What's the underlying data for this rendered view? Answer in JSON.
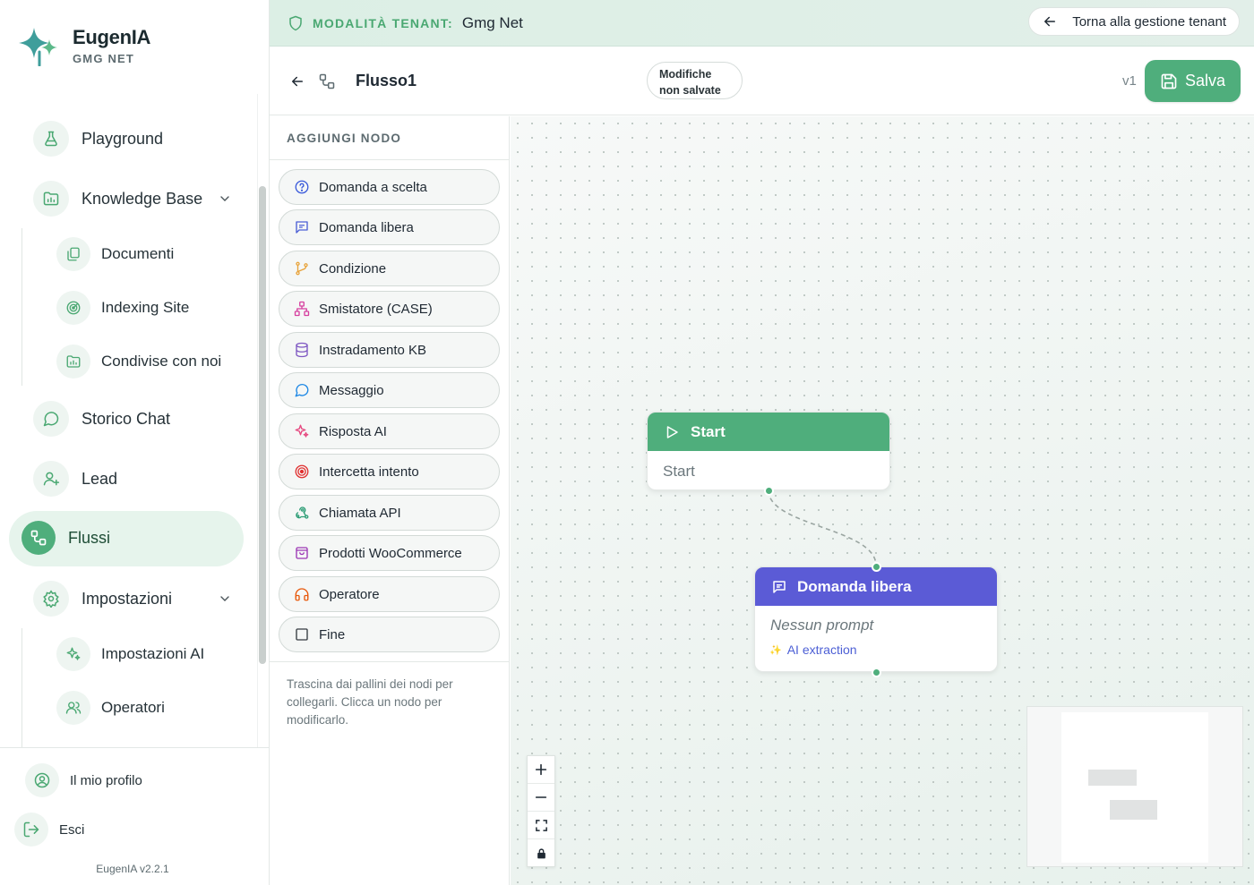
{
  "brand": {
    "name": "EugenIA",
    "tenant_short": "GMG NET"
  },
  "nav": {
    "items": [
      {
        "label": "Playground",
        "icon": "flask-icon"
      },
      {
        "label": "Knowledge Base",
        "icon": "folder-chart-icon"
      },
      {
        "label": "Documenti",
        "icon": "documents-icon"
      },
      {
        "label": "Indexing Site",
        "icon": "radar-icon"
      },
      {
        "label": "Condivise con noi",
        "icon": "folder-chart-icon"
      },
      {
        "label": "Storico Chat",
        "icon": "chat-bubble-icon"
      },
      {
        "label": "Lead",
        "icon": "user-plus-icon"
      },
      {
        "label": "Flussi",
        "icon": "flow-icon",
        "active": true
      },
      {
        "label": "Impostazioni",
        "icon": "gear-icon"
      },
      {
        "label": "Impostazioni AI",
        "icon": "sparkles-icon"
      },
      {
        "label": "Operatori",
        "icon": "users-icon"
      }
    ],
    "profile": "Il mio profilo",
    "logout": "Esci",
    "version": "EugenIA v2.2.1"
  },
  "banner": {
    "label": "MODALITÀ TENANT:",
    "tenant": "Gmg Net",
    "back_label": "Torna alla gestione tenant"
  },
  "toolbar": {
    "flow_name": "Flusso1",
    "unsaved_line1": "Modifiche",
    "unsaved_line2": "non salvate",
    "version": "v1",
    "save_label": "Salva"
  },
  "palette": {
    "title": "AGGIUNGI NODO",
    "items": [
      {
        "label": "Domanda a scelta",
        "icon": "question-circle-icon",
        "color": "#3b5bdb"
      },
      {
        "label": "Domanda libera",
        "icon": "message-square-icon",
        "color": "#4c5fd5"
      },
      {
        "label": "Condizione",
        "icon": "git-branch-icon",
        "color": "#e8a33a"
      },
      {
        "label": "Smistatore (CASE)",
        "icon": "network-icon",
        "color": "#d6409f"
      },
      {
        "label": "Instradamento KB",
        "icon": "database-icon",
        "color": "#7e57c2"
      },
      {
        "label": "Messaggio",
        "icon": "chat-bubble-icon",
        "color": "#1e88e5"
      },
      {
        "label": "Risposta AI",
        "icon": "sparkles-icon",
        "color": "#e64980"
      },
      {
        "label": "Intercetta intento",
        "icon": "target-icon",
        "color": "#e03131"
      },
      {
        "label": "Chiamata API",
        "icon": "webhook-icon",
        "color": "#2f9e77"
      },
      {
        "label": "Prodotti WooCommerce",
        "icon": "shopping-bag-icon",
        "color": "#9c36b5"
      },
      {
        "label": "Operatore",
        "icon": "headphones-icon",
        "color": "#e8590c"
      },
      {
        "label": "Fine",
        "icon": "square-icon",
        "color": "#343a40"
      }
    ],
    "hint": "Trascina dai pallini dei nodi per collegarli. Clicca un nodo per modificarlo."
  },
  "canvas": {
    "nodes": [
      {
        "id": "start",
        "title": "Start",
        "body": "Start",
        "header_color": "#4fae7c"
      },
      {
        "id": "domanda",
        "title": "Domanda libera",
        "body": "Nessun prompt",
        "tag": "AI extraction",
        "header_color": "#5b5bd6"
      }
    ],
    "controls": [
      "zoom-in",
      "zoom-out",
      "fit-view",
      "lock"
    ]
  }
}
